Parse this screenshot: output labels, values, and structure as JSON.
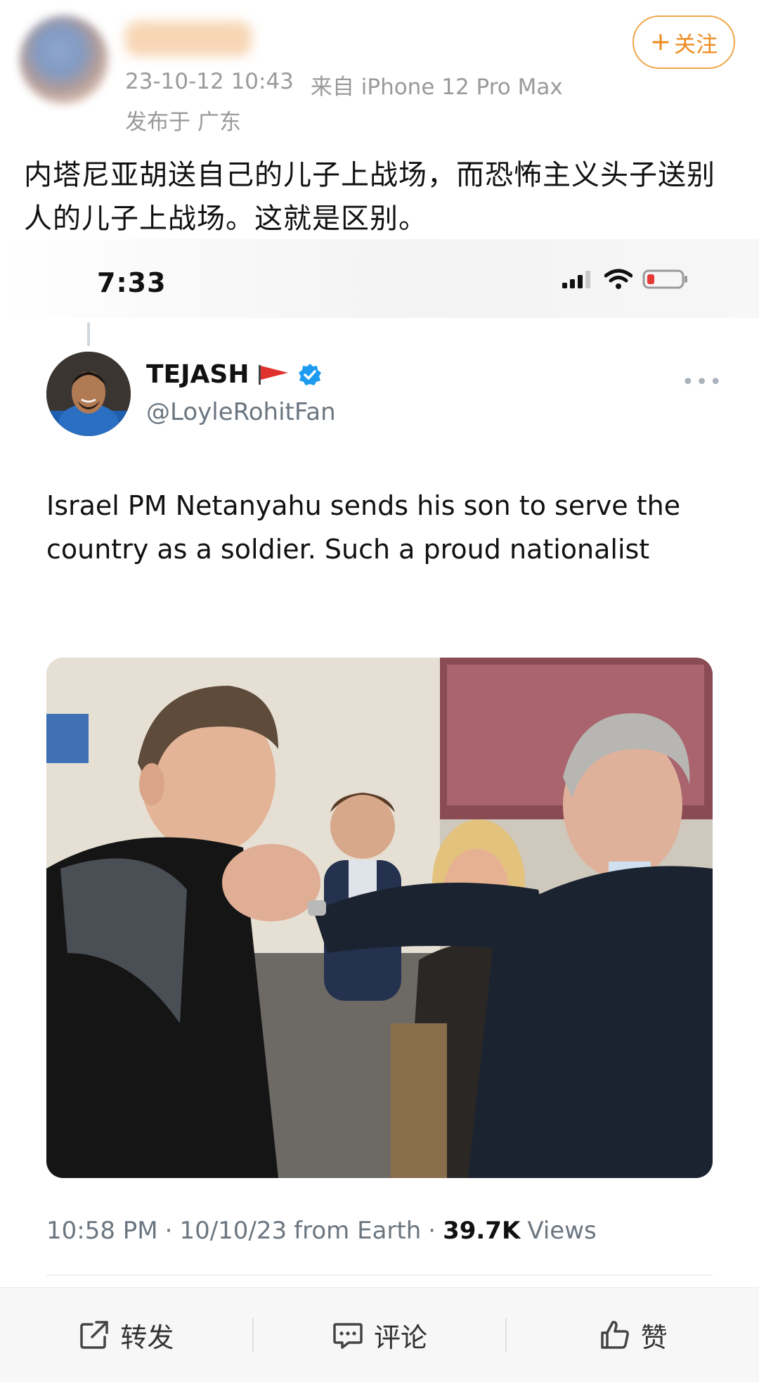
{
  "post": {
    "timestamp": "23-10-12 10:43",
    "source": "来自 iPhone 12 Pro Max",
    "location_prefix": "发布于",
    "location": "广东",
    "follow_label": "关注",
    "text": "内塔尼亚胡送自己的儿子上战场，而恐怖主义头子送别人的儿子上战场。这就是区别。"
  },
  "embed": {
    "status_time": "7:33",
    "tweet": {
      "display_name": "TEJASH",
      "handle": "@LoyleRohitFan",
      "text": "Israel PM Netanyahu sends his son to serve the country as a soldier. Such a proud nationalist",
      "time": "10:58 PM",
      "date": "10/10/23",
      "source": "from Earth",
      "views_count": "39.7K",
      "views_label": "Views",
      "separator": "·"
    }
  },
  "actions": {
    "repost": "转发",
    "comment": "评论",
    "like": "赞"
  },
  "colors": {
    "follow_accent": "#ee8a1d",
    "verified_badge": "#1d9bf0",
    "flag": "#e0322c",
    "meta_gray": "#9a9a9a"
  }
}
